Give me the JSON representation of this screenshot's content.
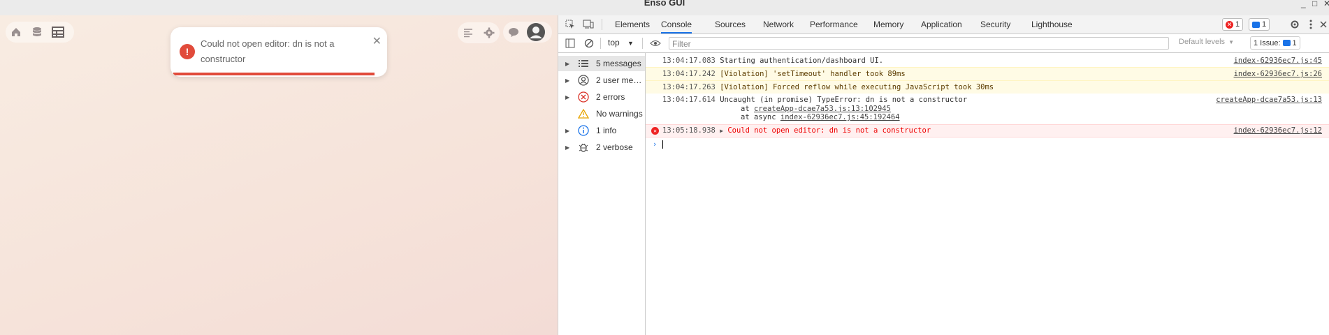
{
  "window": {
    "title": "Enso GUI",
    "controls": [
      "_",
      "□",
      "✕"
    ]
  },
  "app": {
    "left_icons": [
      "home-icon",
      "database-icon",
      "table-icon"
    ],
    "right_icons": [
      "list-icon",
      "gear-icon",
      "chat-icon",
      "avatar"
    ],
    "toast": {
      "message": "Could not open editor: dn is not a constructor",
      "close": "✕",
      "progress": 0.93
    }
  },
  "devtools": {
    "tabs": [
      "Elements",
      "Console",
      "Sources",
      "Network",
      "Performance",
      "Memory",
      "Application",
      "Security",
      "Lighthouse"
    ],
    "active_tab": "Console",
    "error_count": "1",
    "message_count": "1",
    "context": "top",
    "filter_placeholder": "Filter",
    "levels": "Default levels",
    "issues_label": "1 Issue:",
    "issues_count": "1",
    "sidebar": [
      {
        "label": "5 messages",
        "icon": "list-icon"
      },
      {
        "label": "2 user me…",
        "icon": "user-icon"
      },
      {
        "label": "2 errors",
        "icon": "error-icon"
      },
      {
        "label": "No warnings",
        "icon": "warning-icon"
      },
      {
        "label": "1 info",
        "icon": "info-icon"
      },
      {
        "label": "2 verbose",
        "icon": "bug-icon"
      }
    ],
    "logs": [
      {
        "time": "13:04:17.083",
        "text": "Starting authentication/dashboard UI.",
        "source": "index-62936ec7.js:45"
      },
      {
        "time": "13:04:17.242",
        "text": "[Violation] 'setTimeout' handler took 89ms",
        "source": "index-62936ec7.js:26"
      },
      {
        "time": "13:04:17.263",
        "text": "[Violation] Forced reflow while executing JavaScript took 30ms",
        "source": ""
      },
      {
        "time": "13:04:17.614",
        "text": "Uncaught (in promise) TypeError: dn is not a constructor",
        "source": "createApp-dcae7a53.js:13",
        "stack1": "createApp-dcae7a53.js:13:102945",
        "stack2": "index-62936ec7.js:45:192464"
      },
      {
        "time": "13:05:18.938",
        "text": "Could not open editor: dn is not a constructor",
        "source": "index-62936ec7.js:12"
      }
    ],
    "stack_prefix_1": "at",
    "stack_prefix_2": "at async"
  }
}
